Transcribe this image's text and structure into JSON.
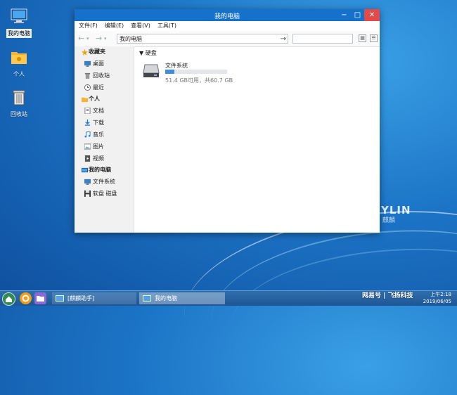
{
  "desktop": {
    "icons": [
      {
        "label": "我的电脑",
        "icon": "computer-icon",
        "selected": true
      },
      {
        "label": "个人",
        "icon": "folder-icon"
      },
      {
        "label": "回收站",
        "icon": "trash-icon"
      }
    ],
    "brand": {
      "text": "YLIN",
      "sub": "麒麟"
    }
  },
  "window": {
    "title": "我的电脑",
    "controls": {
      "minimize": "−",
      "maximize": "□",
      "close": "✕"
    },
    "menu": [
      "文件(F)",
      "编辑(E)",
      "查看(V)",
      "工具(T)"
    ],
    "path": "我的电脑",
    "search_placeholder": "",
    "sidebar": {
      "favorites": {
        "label": "收藏夹",
        "items": [
          "桌面",
          "回收站",
          "最近"
        ]
      },
      "personal": {
        "label": "个人",
        "items": [
          "文档",
          "下载",
          "音乐",
          "图片",
          "视频"
        ]
      },
      "computer": {
        "label": "我的电脑",
        "items": [
          "文件系统",
          "软盘 磁盘"
        ]
      }
    },
    "content": {
      "section": "硬盘",
      "drive": {
        "name": "文件系统",
        "usage": "51.4 GB可用，共60.7 GB",
        "used_fraction": 0.15
      }
    }
  },
  "taskbar": {
    "tasks": [
      "[麒麟助手]",
      "我的电脑"
    ],
    "time": "上午2:18",
    "date": "2019/06/05",
    "watermark": "网易号 | 飞扬科技"
  },
  "colors": {
    "accent": "#1571c9",
    "close": "#e34a4a"
  }
}
